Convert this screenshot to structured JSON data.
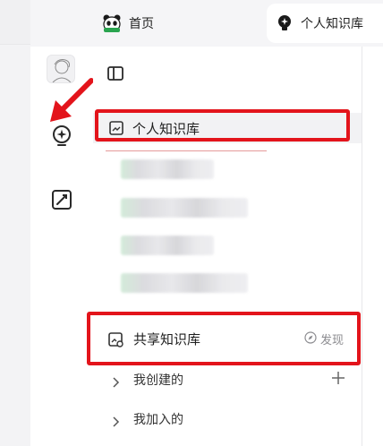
{
  "tabs": {
    "home_label": "首页",
    "kb_label": "个人知识库"
  },
  "sidebar": {
    "personal_kb_label": "个人知识库",
    "shared_kb_label": "共享知识库",
    "discover_label": "发现",
    "groups": [
      {
        "label": "我创建的"
      },
      {
        "label": "我加入的"
      }
    ]
  },
  "colors": {
    "highlight_red": "#e3141b",
    "selected_bg": "#f2f2f4"
  },
  "icons": [
    "panda-icon",
    "lightbulb-icon",
    "panel-toggle-icon",
    "star-bulb-icon",
    "pencil-square-icon",
    "document-icon",
    "shared-doc-icon",
    "compass-icon",
    "chevron-right-icon",
    "plus-icon",
    "red-arrow-icon"
  ]
}
